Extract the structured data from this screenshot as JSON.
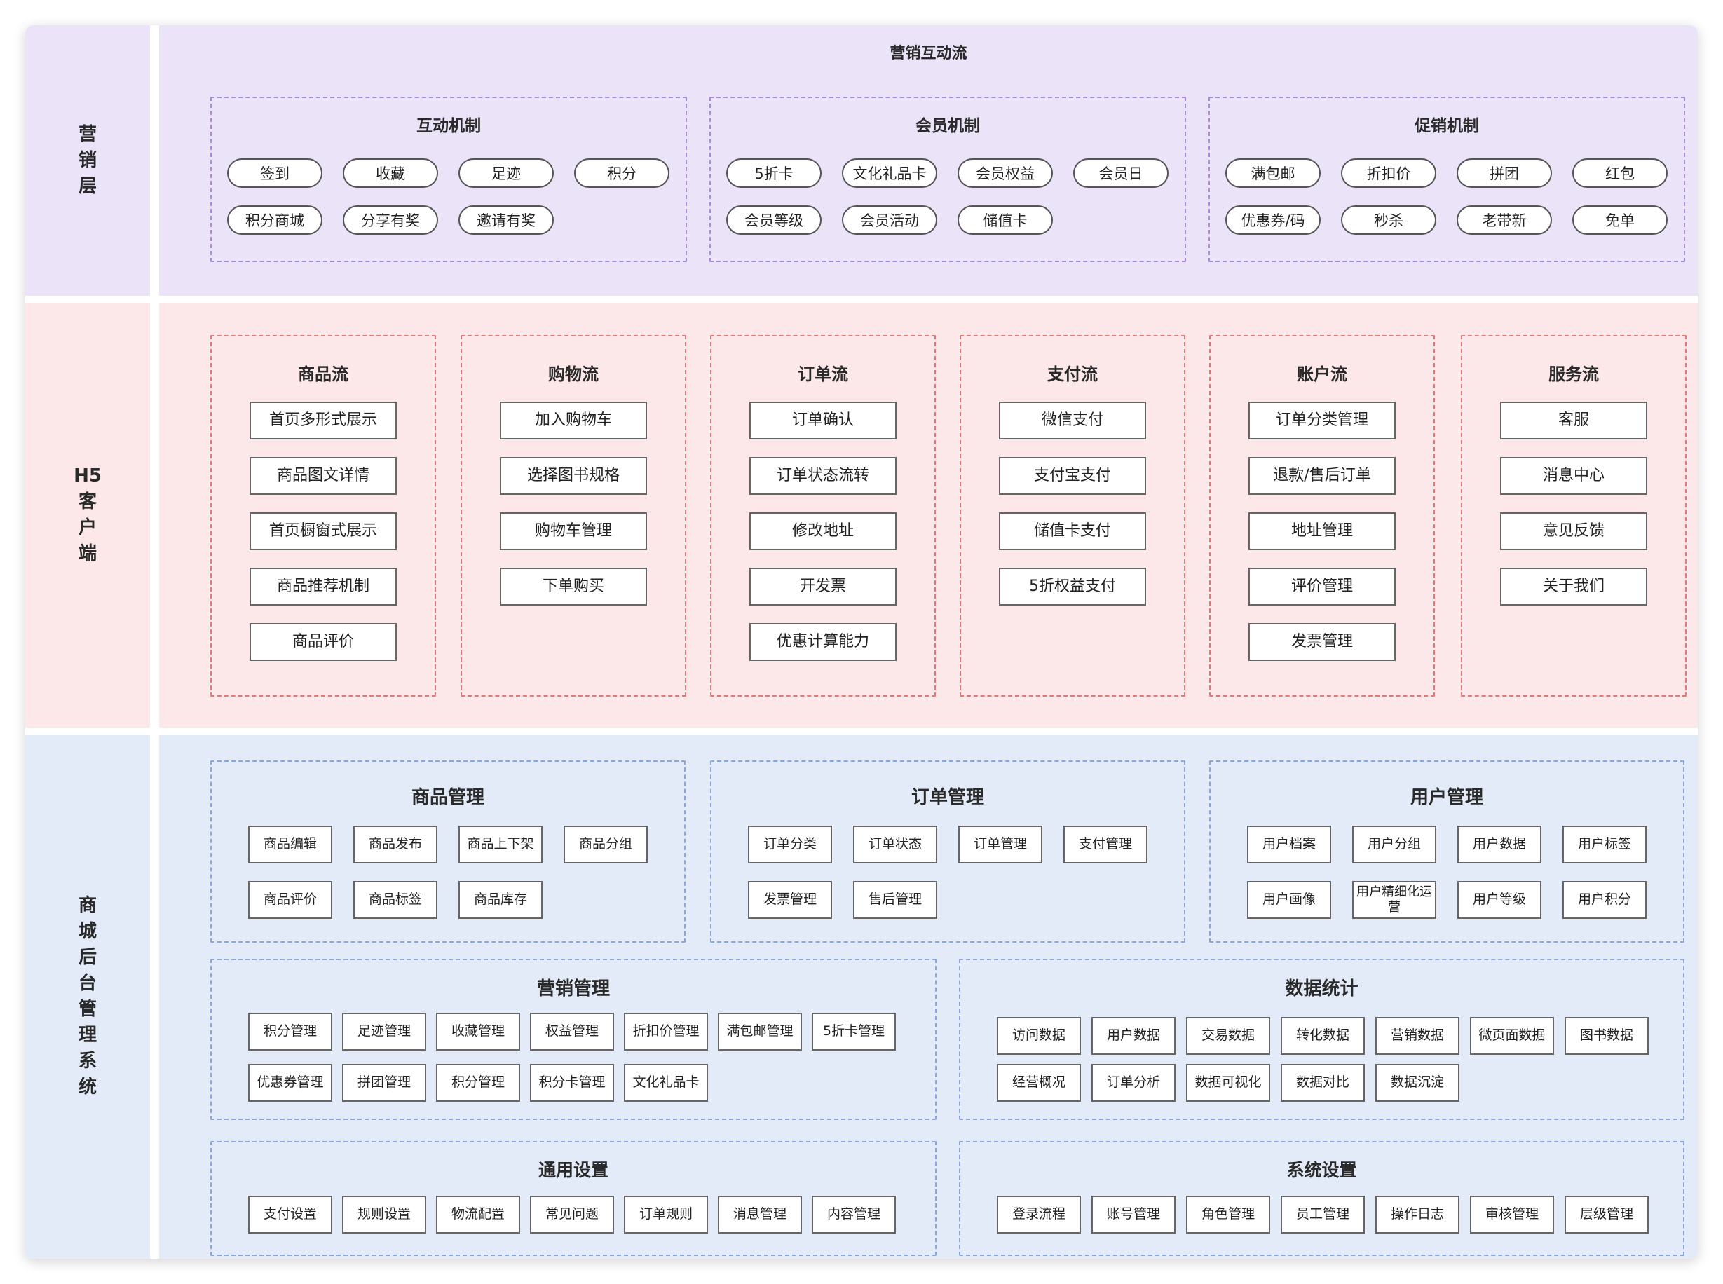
{
  "marketing": {
    "side_label": "营\n销\n层",
    "title": "营销互动流",
    "groups": [
      {
        "title": "互动机制",
        "items": [
          "签到",
          "收藏",
          "足迹",
          "积分",
          "积分商城",
          "分享有奖",
          "邀请有奖"
        ]
      },
      {
        "title": "会员机制",
        "items": [
          "5折卡",
          "文化礼品卡",
          "会员权益",
          "会员日",
          "会员等级",
          "会员活动",
          "储值卡"
        ]
      },
      {
        "title": "促销机制",
        "items": [
          "满包邮",
          "折扣价",
          "拼团",
          "红包",
          "优惠券/码",
          "秒杀",
          "老带新",
          "免单"
        ]
      }
    ]
  },
  "h5": {
    "side_label": "H5\n客\n户\n端",
    "groups": [
      {
        "title": "商品流",
        "items": [
          "首页多形式展示",
          "商品图文详情",
          "首页橱窗式展示",
          "商品推荐机制",
          "商品评价"
        ]
      },
      {
        "title": "购物流",
        "items": [
          "加入购物车",
          "选择图书规格",
          "购物车管理",
          "下单购买"
        ]
      },
      {
        "title": "订单流",
        "items": [
          "订单确认",
          "订单状态流转",
          "修改地址",
          "开发票",
          "优惠计算能力"
        ]
      },
      {
        "title": "支付流",
        "items": [
          "微信支付",
          "支付宝支付",
          "储值卡支付",
          "5折权益支付"
        ]
      },
      {
        "title": "账户流",
        "items": [
          "订单分类管理",
          "退款/售后订单",
          "地址管理",
          "评价管理",
          "发票管理"
        ]
      },
      {
        "title": "服务流",
        "items": [
          "客服",
          "消息中心",
          "意见反馈",
          "关于我们"
        ]
      }
    ]
  },
  "admin": {
    "side_label": "商\n城\n后\n台\n管\n理\n系\n统",
    "groups": [
      {
        "title": "商品管理",
        "items": [
          "商品编辑",
          "商品发布",
          "商品上下架",
          "商品分组",
          "商品评价",
          "商品标签",
          "商品库存"
        ]
      },
      {
        "title": "订单管理",
        "items": [
          "订单分类",
          "订单状态",
          "订单管理",
          "支付管理",
          "发票管理",
          "售后管理"
        ]
      },
      {
        "title": "用户管理",
        "items": [
          "用户档案",
          "用户分组",
          "用户数据",
          "用户标签",
          "用户画像",
          "用户精细化运营",
          "用户等级",
          "用户积分"
        ]
      },
      {
        "title": "营销管理",
        "items": [
          "积分管理",
          "足迹管理",
          "收藏管理",
          "权益管理",
          "折扣价管理",
          "满包邮管理",
          "5折卡管理",
          "优惠券管理",
          "拼团管理",
          "积分管理",
          "积分卡管理",
          "文化礼品卡"
        ]
      },
      {
        "title": "数据统计",
        "items": [
          "访问数据",
          "用户数据",
          "交易数据",
          "转化数据",
          "营销数据",
          "微页面数据",
          "图书数据",
          "经营概况",
          "订单分析",
          "数据可视化",
          "数据对比",
          "数据沉淀"
        ]
      },
      {
        "title": "通用设置",
        "items": [
          "支付设置",
          "规则设置",
          "物流配置",
          "常见问题",
          "订单规则",
          "消息管理",
          "内容管理"
        ]
      },
      {
        "title": "系统设置",
        "items": [
          "登录流程",
          "账号管理",
          "角色管理",
          "员工管理",
          "操作日志",
          "审核管理",
          "层级管理"
        ]
      }
    ]
  }
}
